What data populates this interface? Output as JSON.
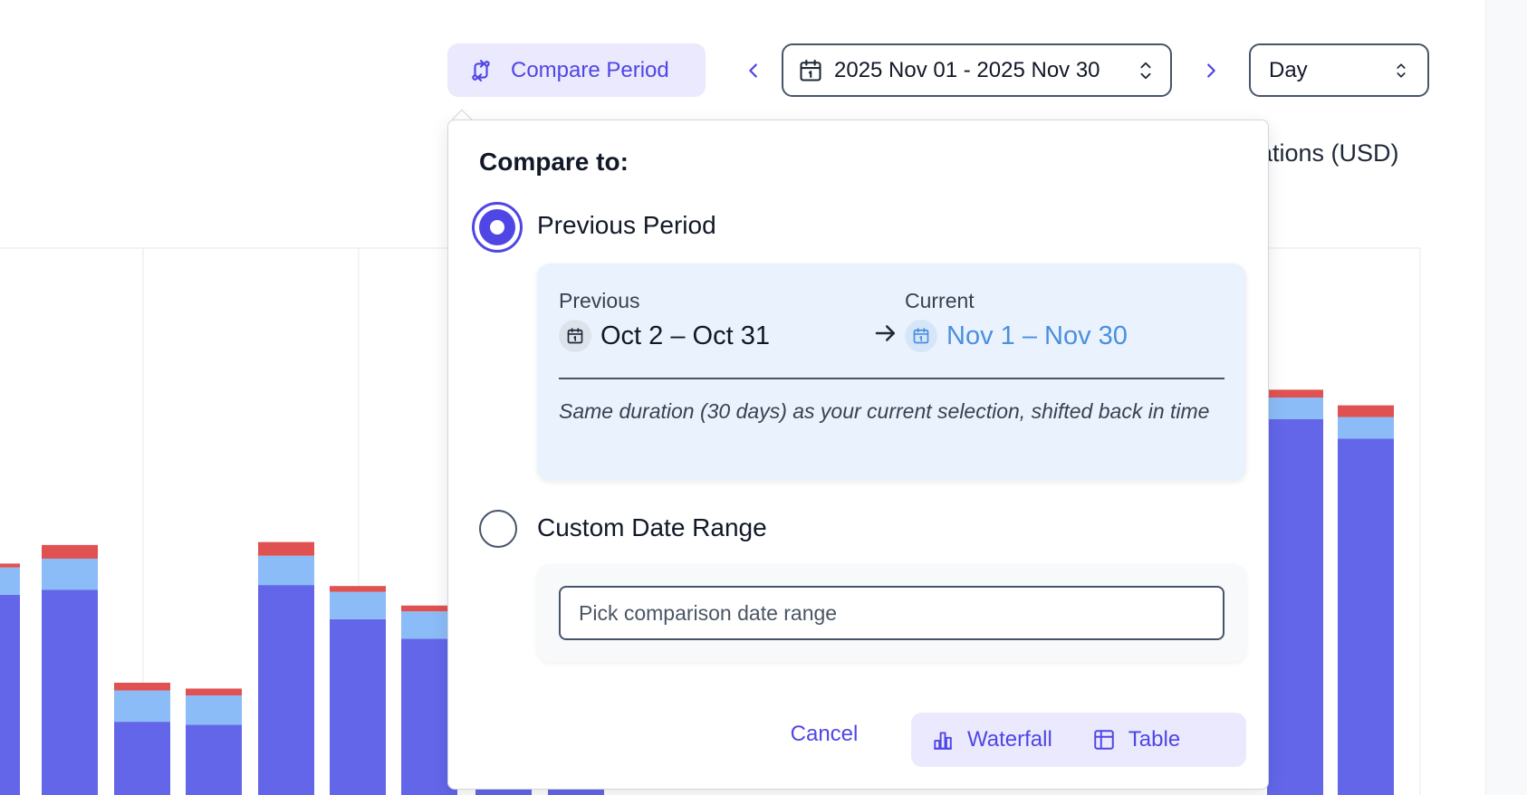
{
  "toolbar": {
    "compare_label": "Compare Period",
    "compare_icon": "compare-arrows-icon",
    "date_range": "2025 Nov 01 - 2025 Nov 30",
    "granularity": "Day"
  },
  "chart_title_fragment": "ations (USD)",
  "colors": {
    "accent": "#4f46e5",
    "bar_primary": "#6366e8",
    "bar_secondary": "#8bbcf7",
    "bar_tertiary": "#e05252"
  },
  "chart_data": {
    "type": "bar",
    "stacked": true,
    "title": "",
    "xlabel": "",
    "ylabel": "",
    "series": [
      {
        "values": [
          205,
          210,
          75,
          72,
          215,
          180,
          160,
          160,
          205,
          385,
          365
        ]
      },
      {
        "values": [
          28,
          32,
          32,
          30,
          30,
          28,
          28,
          28,
          30,
          22,
          22
        ]
      },
      {
        "values": [
          4,
          14,
          8,
          7,
          14,
          6,
          6,
          6,
          6,
          8,
          12
        ]
      }
    ],
    "visible_categories": 11,
    "ymax": 560
  },
  "popover": {
    "title": "Compare to:",
    "previous_option": {
      "label": "Previous Period",
      "checked": true,
      "previous_caption": "Previous",
      "previous_range": "Oct 2 – Oct 31",
      "current_caption": "Current",
      "current_range": "Nov 1 – Nov 30",
      "note": "Same duration (30 days) as your current selection, shifted back in time"
    },
    "custom_option": {
      "label": "Custom Date Range",
      "checked": false,
      "placeholder": "Pick comparison date range"
    },
    "cancel_label": "Cancel",
    "waterfall_label": "Waterfall",
    "table_label": "Table"
  }
}
